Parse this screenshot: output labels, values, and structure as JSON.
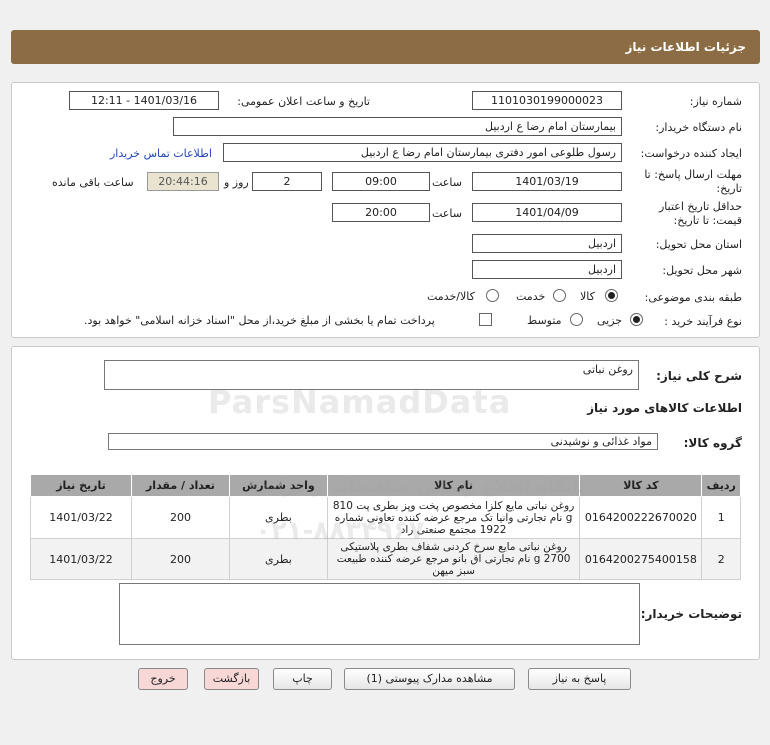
{
  "header": {
    "title": "جزئیات اطلاعات نیاز"
  },
  "form": {
    "need_number_label": "شماره نیاز:",
    "need_number": "1101030199000023",
    "announce_label": "تاریخ و ساعت اعلان عمومی:",
    "announce_value": "1401/03/16 - 12:11",
    "buyer_org_label": "نام دستگاه خریدار:",
    "buyer_org": "بیمارستان امام رضا  ع  اردبیل",
    "requester_label": "ایجاد کننده درخواست:",
    "requester": "رسول طلوعی امور دفتری بیمارستان امام رضا  ع  اردبیل",
    "contact_link": "اطلاعات تماس خریدار",
    "deadline_label_1": "مهلت ارسال پاسخ: تا",
    "deadline_label_2": "تاریخ:",
    "deadline_date": "1401/03/19",
    "time_label": "ساعت",
    "deadline_time": "09:00",
    "days_value": "2",
    "days_label": "روز و",
    "remaining_time": "20:44:16",
    "remaining_label": "ساعت باقی مانده",
    "validity_label_1": "حداقل تاریخ اعتبار",
    "validity_label_2": "قیمت: تا تاریخ:",
    "validity_date": "1401/04/09",
    "validity_time": "20:00",
    "province_label": "استان محل تحویل:",
    "province": "اردبیل",
    "city_label": "شهر محل تحویل:",
    "city": "اردبیل",
    "category_label": "طبقه بندی موضوعی:",
    "category_options": [
      "کالا",
      "خدمت",
      "کالا/خدمت"
    ],
    "process_label": "نوع فرآیند خرید :",
    "process_options": [
      "جزیی",
      "متوسط"
    ],
    "payment_note": "پرداخت تمام یا بخشی از مبلغ خرید،از محل \"اسناد خزانه اسلامی\" خواهد بود."
  },
  "summary": {
    "description_label": "شرح کلی نیاز:",
    "description": "روغن نباتی",
    "goods_info_title": "اطلاعات کالاهای مورد نیاز",
    "goods_group_label": "گروه کالا:",
    "goods_group": "مواد غذائی و نوشیدنی"
  },
  "table": {
    "headers": [
      "ردیف",
      "کد کالا",
      "نام کالا",
      "واحد شمارش",
      "تعداد / مقدار",
      "تاریخ نیاز"
    ],
    "rows": [
      {
        "row": "1",
        "code": "0164200222670020",
        "name": "روغن نباتی مایع کلزا مخصوص پخت وپز بطری پت 810 g نام تجارتی وانیا تک مرجع عرضه کننده تعاونی شماره 1922 مجتمع صنعتی راد",
        "unit": "بطری",
        "qty": "200",
        "date": "1401/03/22"
      },
      {
        "row": "2",
        "code": "0164200275400158",
        "name": "روغن نباتی مایع سرخ کردنی شفاف بطری پلاستیکی 2700 g نام تجارتی اق بانو مرجع عرضه کننده طبیعت سبز میهن",
        "unit": "بطری",
        "qty": "200",
        "date": "1401/03/22"
      }
    ]
  },
  "buyer_notes": {
    "label": "توضیحات خریدار:",
    "value": ""
  },
  "buttons": {
    "reply": "پاسخ به نیاز",
    "attachments": "مشاهده مدارک پیوستی (1)",
    "print": "چاپ",
    "back": "بازگشت",
    "exit": "خروج"
  },
  "watermark": {
    "brand": "ParsNamadData",
    "line1": "پایگاه اطلاع رسانی مناقصات و مزایده",
    "line2": "۰۲۱-۸۸۳۴۹۶۷۰"
  }
}
